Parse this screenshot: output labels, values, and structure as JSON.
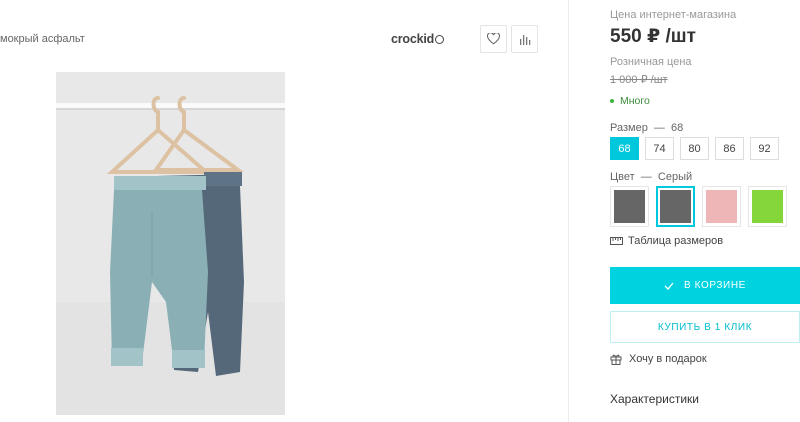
{
  "product": {
    "name_fragment": "мокрый асфальт",
    "brand": "crockid"
  },
  "actions": {
    "favorite_icon": "heart-icon",
    "compare_icon": "bar-chart-icon"
  },
  "price": {
    "online_label": "Цена интернет-магазина",
    "online_value": "550 ₽ /шт",
    "retail_label": "Розничная цена",
    "retail_value": "1 000 ₽ /шт",
    "stock_text": "Много"
  },
  "size": {
    "label": "Размер",
    "selected": "68",
    "options": [
      "68",
      "74",
      "80",
      "86",
      "92"
    ]
  },
  "color": {
    "label": "Цвет",
    "selected": "Серый",
    "swatches": [
      "#666666",
      "#666666",
      "#efb6b8",
      "#84d63a"
    ],
    "active_index": 1
  },
  "size_table_link": "Таблица размеров",
  "buttons": {
    "cart": "В КОРЗИНЕ",
    "one_click": "КУПИТЬ В 1 КЛИК"
  },
  "gift_link": "Хочу в подарок",
  "characteristics": "Характеристики",
  "colors": {
    "accent": "#00d2df",
    "in_stock": "#3db43d"
  }
}
